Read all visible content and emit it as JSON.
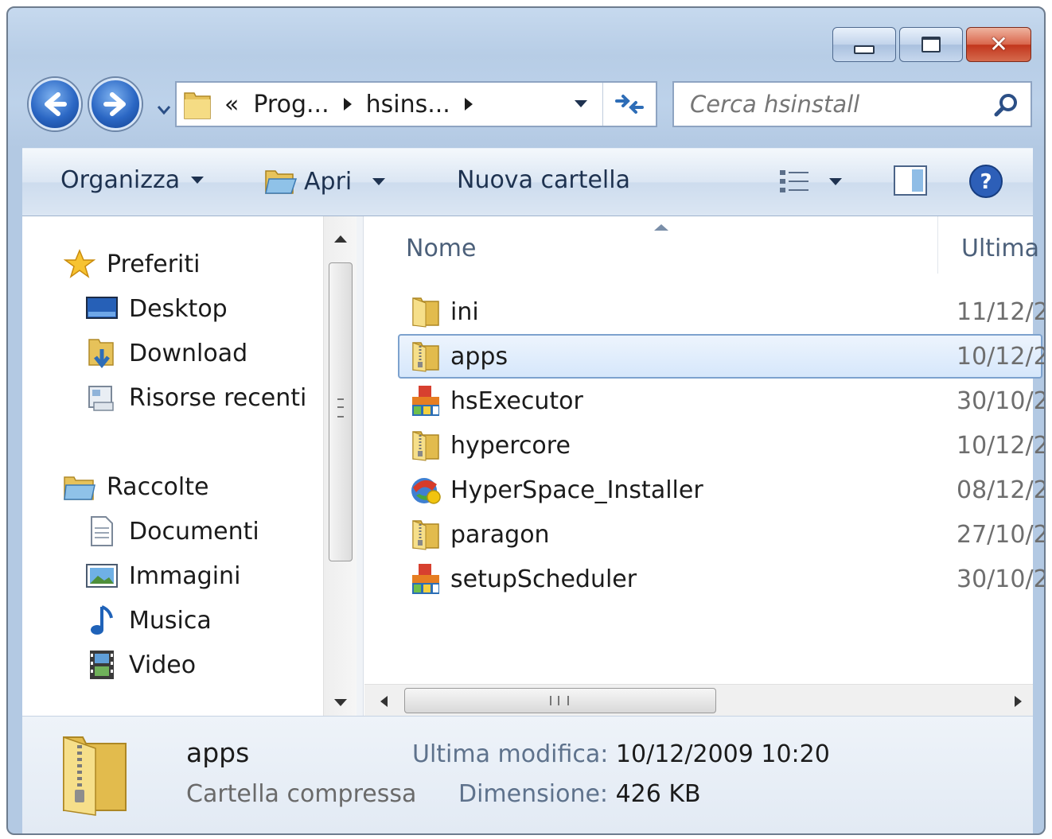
{
  "window": {
    "caption": {
      "minimize": "",
      "maximize": "",
      "close": ""
    }
  },
  "address": {
    "overflow": "«",
    "crumbs": [
      "Prog...",
      "hsins..."
    ]
  },
  "search": {
    "placeholder": "Cerca hsinstall"
  },
  "toolbar": {
    "organize": "Organizza",
    "open": "Apri",
    "new_folder": "Nuova cartella"
  },
  "nav": {
    "favorites": {
      "label": "Preferiti",
      "icon": "star-icon"
    },
    "favorites_items": [
      {
        "label": "Desktop",
        "icon": "desktop-icon"
      },
      {
        "label": "Download",
        "icon": "download-folder-icon"
      },
      {
        "label": "Risorse recenti",
        "icon": "recent-places-icon"
      }
    ],
    "libraries": {
      "label": "Raccolte",
      "icon": "libraries-icon"
    },
    "libraries_items": [
      {
        "label": "Documenti",
        "icon": "documents-icon"
      },
      {
        "label": "Immagini",
        "icon": "pictures-icon"
      },
      {
        "label": "Musica",
        "icon": "music-icon"
      },
      {
        "label": "Video",
        "icon": "video-icon"
      }
    ]
  },
  "columns": {
    "name": "Nome",
    "modified": "Ultima"
  },
  "files": [
    {
      "name": "ini",
      "date": "11/12/2",
      "icon": "folder-icon"
    },
    {
      "name": "apps",
      "date": "10/12/2",
      "icon": "zip-folder-icon",
      "selected": true
    },
    {
      "name": "hsExecutor",
      "date": "30/10/2",
      "icon": "installer-icon"
    },
    {
      "name": "hypercore",
      "date": "10/12/2",
      "icon": "zip-folder-icon"
    },
    {
      "name": "HyperSpace_Installer",
      "date": "08/12/2",
      "icon": "setup-icon"
    },
    {
      "name": "paragon",
      "date": "27/10/2",
      "icon": "zip-folder-icon"
    },
    {
      "name": "setupScheduler",
      "date": "30/10/2",
      "icon": "installer-icon"
    }
  ],
  "details": {
    "name": "apps",
    "type": "Cartella compressa",
    "modified_label": "Ultima modifica:",
    "modified_value": "10/12/2009 10:20",
    "size_label": "Dimensione:",
    "size_value": "426 KB"
  },
  "colors": {
    "selection_border": "#7da2ce",
    "selection_fill": "#d6e7fb",
    "close_button": "#c2351c"
  }
}
